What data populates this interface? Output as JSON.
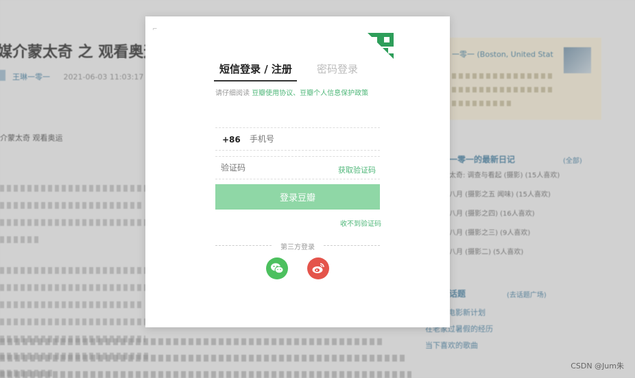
{
  "background": {
    "title": "媒介蒙太奇 之 观看奥运",
    "author": "王琳一零一",
    "date": "2021-06-03 11:03:17",
    "lead": "介蒙太奇 观看奥运",
    "profile_name": "一零一 (Boston, United Stat",
    "diary_title": "一零一的最新日记",
    "diary_all": "(全部)",
    "diary_items": [
      "太奇: 调查与看起 (摄影) (15人喜欢)",
      "八月 (摄影之五 闻味) (15人喜欢)",
      "八月 (摄影之四) (16人喜欢)",
      "八月 (摄影之三) (9人喜欢)",
      "八月 (摄影二) (5人喜欢)"
    ],
    "topics_title": "话题",
    "topics_all": "(去话题广场)",
    "topics": [
      "身边的电影新计划",
      "在老家过暑假的经历",
      "当下喜欢的歌曲"
    ]
  },
  "modal": {
    "tabs": [
      {
        "label": "短信登录 / 注册",
        "active": true
      },
      {
        "label": "密码登录",
        "active": false
      }
    ],
    "agreement": {
      "prefix": "请仔细阅读",
      "link1": "豆瓣使用协议、豆瓣个人信息保护政策"
    },
    "phone": {
      "country_code": "+86",
      "placeholder": "手机号",
      "value": ""
    },
    "code": {
      "placeholder": "验证码",
      "value": "",
      "get_code_label": "获取验证码"
    },
    "login_button": "登录豆瓣",
    "no_code_link": "收不到验证码",
    "third_party_label": "第三方登录",
    "social": [
      {
        "name": "wechat",
        "color": "#4cc05e"
      },
      {
        "name": "weibo",
        "color": "#e4544b"
      }
    ]
  },
  "colors": {
    "accent": "#4fb779",
    "button": "#8fd7a6"
  },
  "watermark": "CSDN @Jum朱"
}
